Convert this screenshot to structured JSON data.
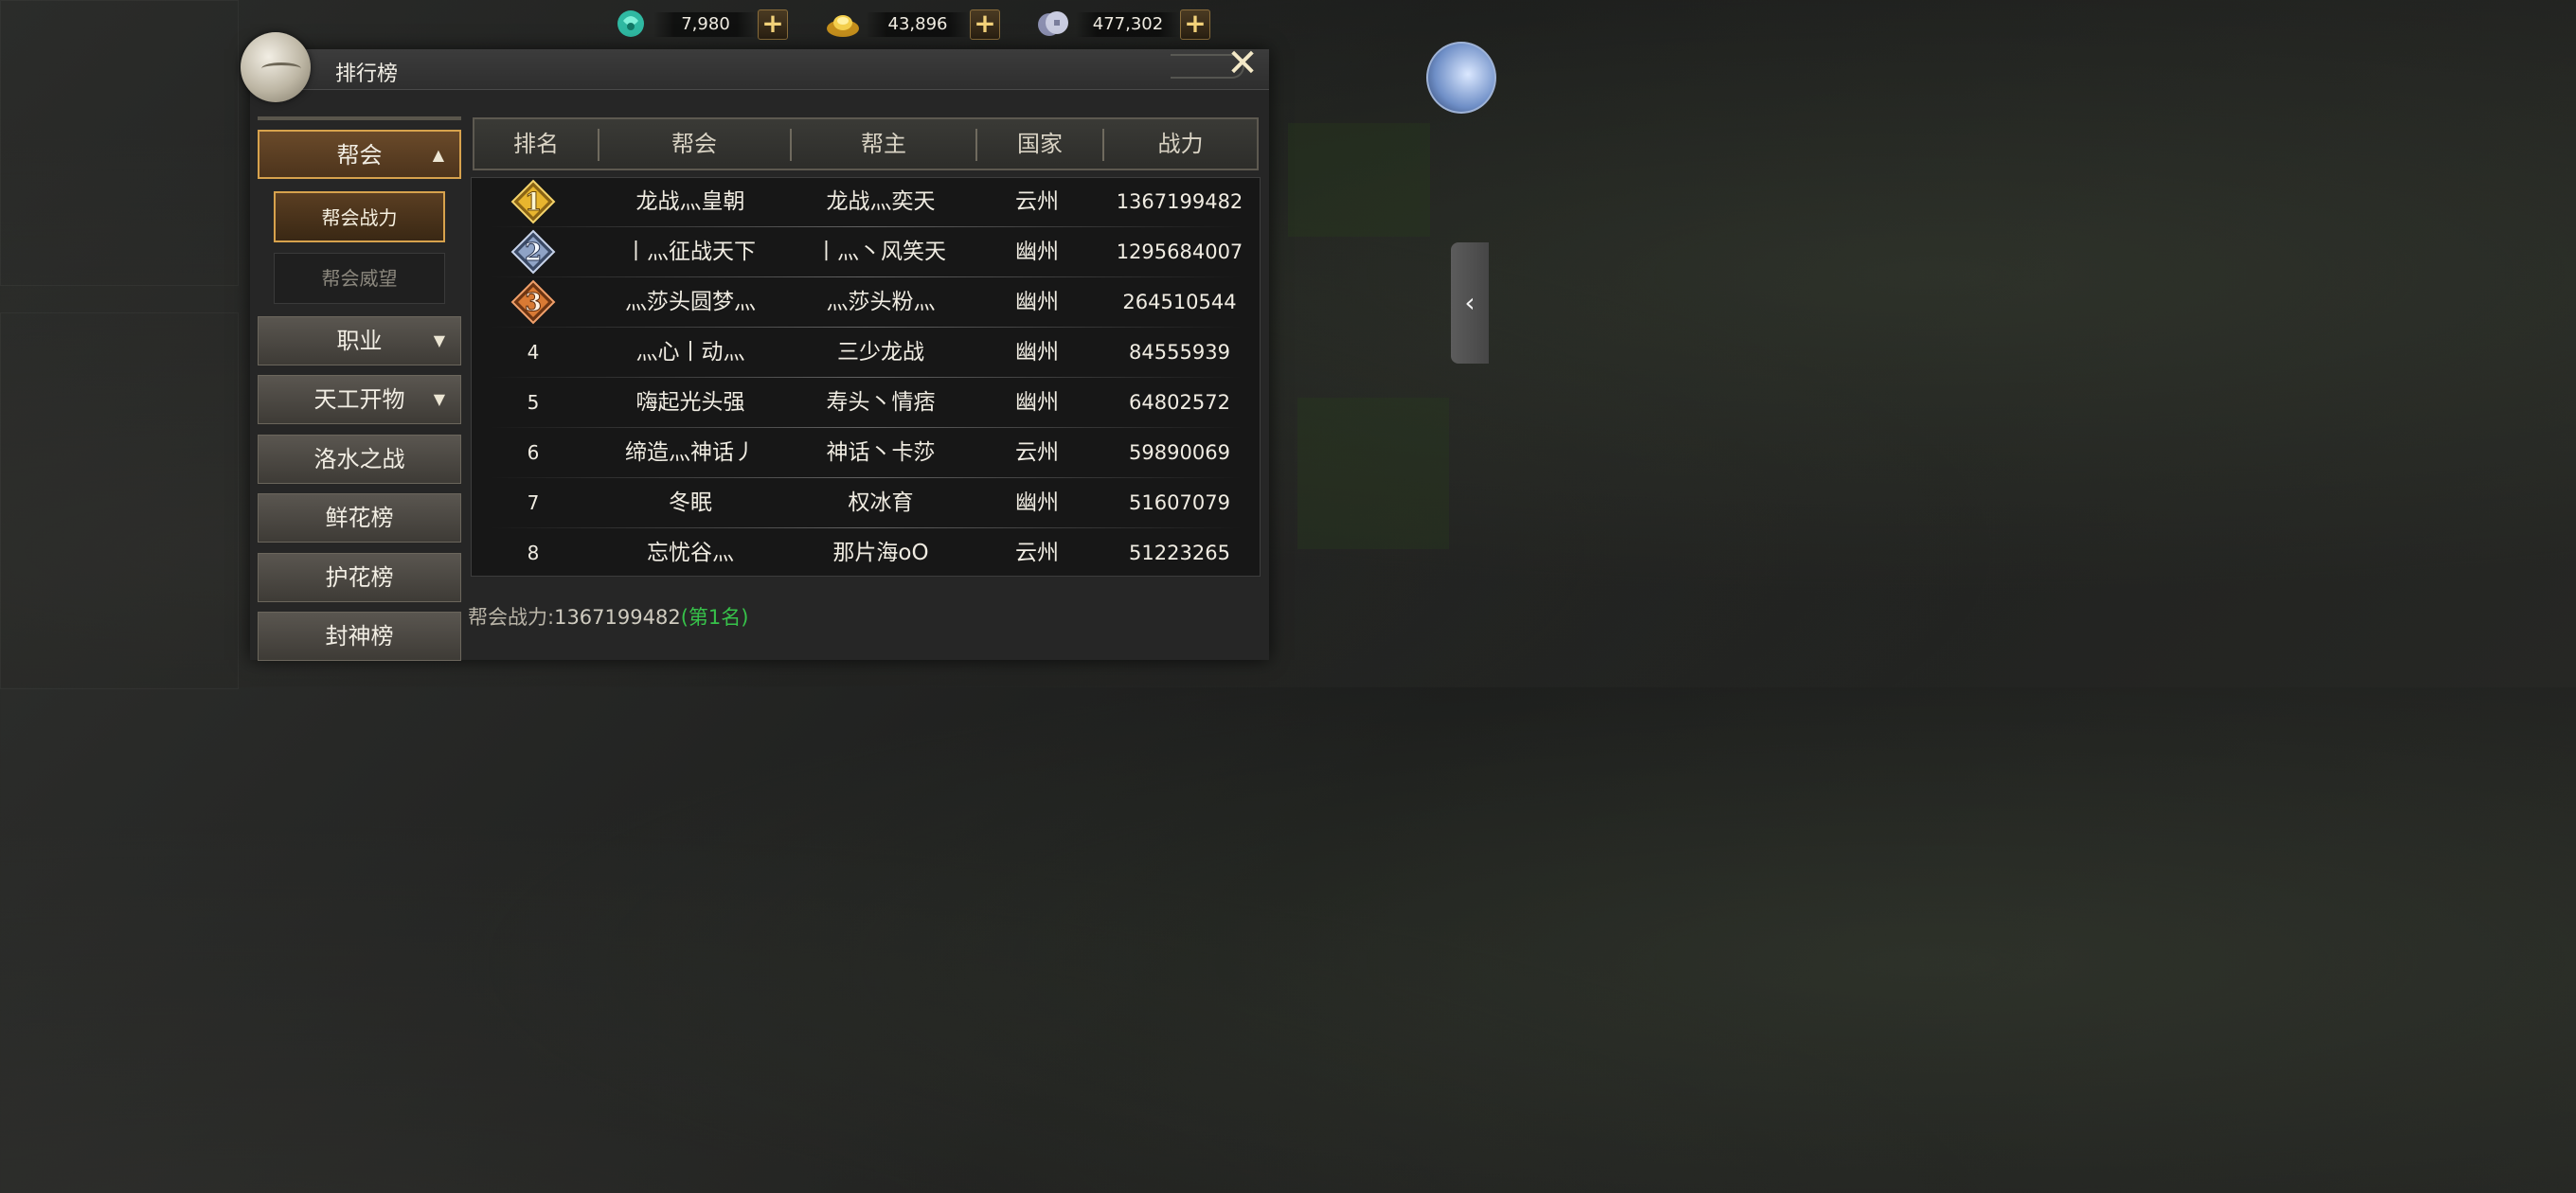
{
  "colors": {
    "accent_gold": "#d7a24d",
    "rank_highlight_green": "#37c24a",
    "panel_bg": "#262626",
    "table_bg": "#171717"
  },
  "currencies": [
    {
      "icon": "jade-coin-icon",
      "value": "7,980"
    },
    {
      "icon": "gold-ingot-icon",
      "value": "43,896"
    },
    {
      "icon": "silver-coin-icon",
      "value": "477,302"
    }
  ],
  "panel": {
    "title": "排行榜",
    "close_icon": "close-x-icon"
  },
  "menu": {
    "categories": [
      {
        "label": "帮会",
        "arrow": "▲"
      },
      {
        "label": "职业",
        "arrow": "▼"
      },
      {
        "label": "天工开物",
        "arrow": "▼"
      },
      {
        "label": "洛水之战"
      },
      {
        "label": "鲜花榜"
      },
      {
        "label": "护花榜"
      },
      {
        "label": "封神榜"
      }
    ],
    "subitems": [
      {
        "label": "帮会战力"
      },
      {
        "label": "帮会威望"
      }
    ]
  },
  "table": {
    "headers": [
      "排名",
      "帮会",
      "帮主",
      "国家",
      "战力"
    ],
    "rows": [
      {
        "rank": "1",
        "guild": "龙战灬皇朝",
        "leader": "龙战灬奕天",
        "country": "云州",
        "power": "1367199482"
      },
      {
        "rank": "2",
        "guild": "丨灬征战天下",
        "leader": "丨灬丶风笑天",
        "country": "幽州",
        "power": "1295684007"
      },
      {
        "rank": "3",
        "guild": "灬莎头圆梦灬",
        "leader": "灬莎头粉灬",
        "country": "幽州",
        "power": "264510544"
      },
      {
        "rank": "4",
        "guild": "灬心丨动灬",
        "leader": "三少龙战",
        "country": "幽州",
        "power": "84555939"
      },
      {
        "rank": "5",
        "guild": "嗨起光头强",
        "leader": "寿头丶情痞",
        "country": "幽州",
        "power": "64802572"
      },
      {
        "rank": "6",
        "guild": "缔造灬神话丿",
        "leader": "神话丶卡莎",
        "country": "云州",
        "power": "59890069"
      },
      {
        "rank": "7",
        "guild": "冬眠",
        "leader": "权冰育",
        "country": "幽州",
        "power": "51607079"
      },
      {
        "rank": "8",
        "guild": "忘忧谷灬",
        "leader": "那片海oO",
        "country": "云州",
        "power": "51223265"
      }
    ]
  },
  "footer": {
    "label": "帮会战力:",
    "value": "1367199482",
    "rank_text": "(第1名)"
  },
  "side": {
    "collapse_icon": "chevron-left-icon",
    "collapse_glyph": "‹"
  }
}
